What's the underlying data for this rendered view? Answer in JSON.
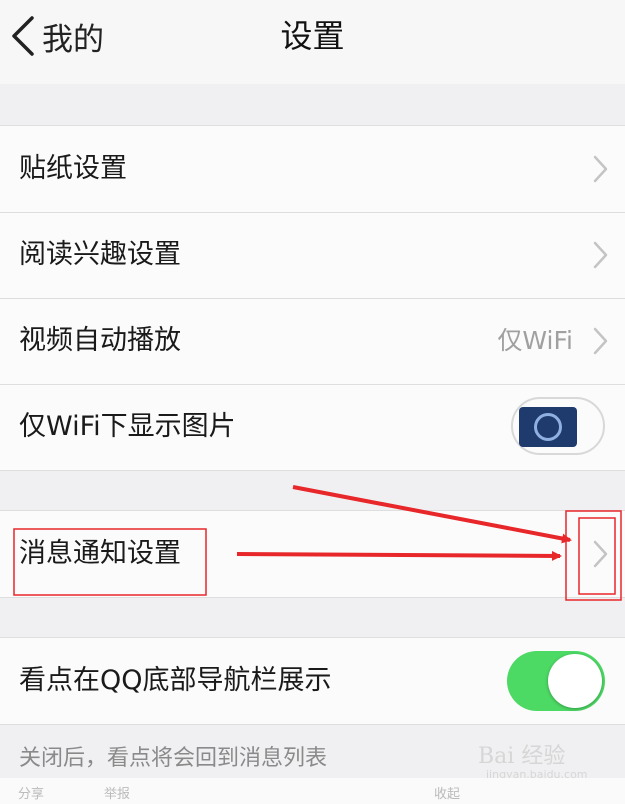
{
  "nav": {
    "back_label": "我的",
    "title": "设置"
  },
  "group1": [
    {
      "label": "贴纸设置"
    },
    {
      "label": "阅读兴趣设置"
    },
    {
      "label": "视频自动播放",
      "value": "仅WiFi"
    },
    {
      "label": "仅WiFi下显示图片"
    }
  ],
  "group2": [
    {
      "label": "消息通知设置"
    }
  ],
  "group3": [
    {
      "label": "看点在QQ底部导航栏展示"
    }
  ],
  "footer_note": "关闭后，看点将会回到消息列表",
  "watermark": {
    "share": "分享",
    "report": "举报",
    "collapse": "收起",
    "brand": "Bai 经验",
    "url": "jingyan.baidu.com"
  },
  "colors": {
    "toggle_on": "#4cd964",
    "annotation_red": "#e8272a"
  },
  "icons": [
    "chevron-left-icon",
    "chevron-right-icon"
  ]
}
